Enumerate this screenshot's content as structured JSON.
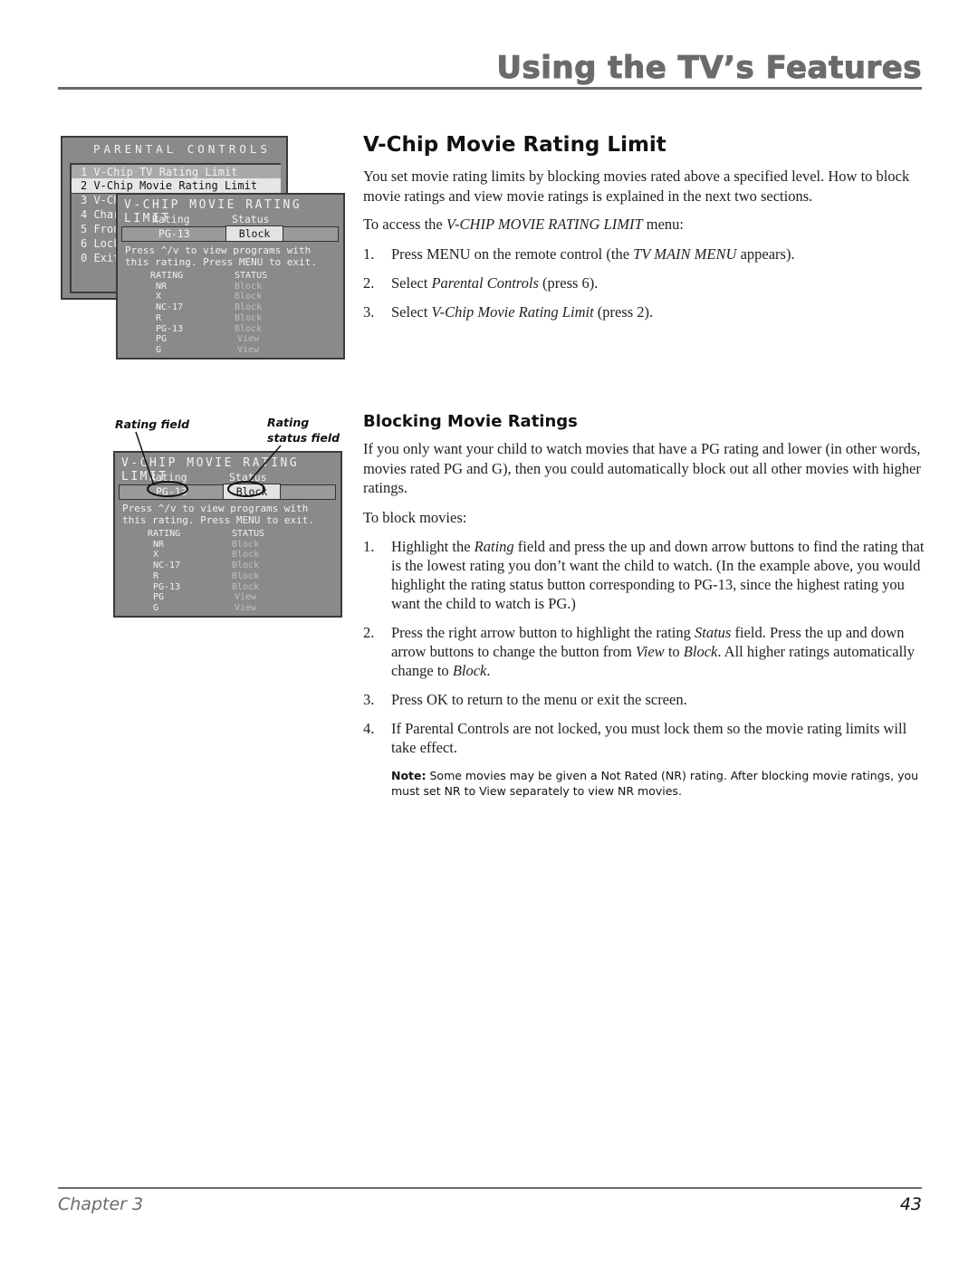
{
  "header": {
    "title": "Using the TV’s Features"
  },
  "parental_controls_menu": {
    "title": "PARENTAL CONTROLS",
    "items": [
      {
        "label": "1 V-Chip TV Rating Limit"
      },
      {
        "label": "2 V-Chip Movie Rating Limit"
      },
      {
        "label": "3 V-Ch"
      },
      {
        "label": "4 Char"
      },
      {
        "label": "5 Fron"
      },
      {
        "label": "6 Lock"
      },
      {
        "label": "0 Exit"
      }
    ]
  },
  "vchip_menu": {
    "title": "V-CHIP MOVIE RATING LIMIT",
    "rating_header": "Rating",
    "status_header": "Status",
    "rating_value": "PG-13",
    "status_value": "Block",
    "message_line1": "Press ^/v to view programs with",
    "message_line2": "this rating. Press MENU to exit.",
    "table_header": {
      "rating": "RATING",
      "status": "STATUS"
    },
    "rows": [
      {
        "rating": "NR",
        "status": "Block"
      },
      {
        "rating": "X",
        "status": "Block"
      },
      {
        "rating": "NC-17",
        "status": "Block"
      },
      {
        "rating": "R",
        "status": "Block"
      },
      {
        "rating": "PG-13",
        "status": "Block"
      },
      {
        "rating": "PG",
        "status": "View"
      },
      {
        "rating": "G",
        "status": "View"
      }
    ]
  },
  "callouts": {
    "rating_field": "Rating field",
    "rating_status_line1": "Rating",
    "rating_status_line2": "status field"
  },
  "section1": {
    "heading": "V-Chip Movie Rating Limit",
    "intro": "You set movie rating limits by blocking movies rated above a specified level. How to block movie ratings and view movie ratings is explained in the next two sections.",
    "access_pre": "To access the ",
    "access_em": "V-CHIP MOVIE RATING LIMIT",
    "access_post": " menu:",
    "steps": [
      {
        "num": "1.",
        "pre": "Press MENU on the remote control (the ",
        "em": "TV MAIN MENU",
        "post": " appears)."
      },
      {
        "num": "2.",
        "pre": "Select ",
        "em": "Parental Controls",
        "post": " (press 6)."
      },
      {
        "num": "3.",
        "pre": "Select ",
        "em": "V-Chip Movie Rating Limit",
        "post": " (press 2)."
      }
    ]
  },
  "section2": {
    "heading": "Blocking Movie Ratings",
    "intro": "If you only want your child to watch movies that have a PG rating and lower (in other words, movies rated PG and G), then you could automatically block out all other movies with higher ratings.",
    "lead": "To block movies:",
    "step1": {
      "num": "1.",
      "pre": "Highlight the ",
      "em": "Rating",
      "post": " field and press the up and down arrow buttons to find the rating that is the lowest rating you don’t want the child to watch.  (In the example above, you would highlight the rating status button corresponding to PG-13, since the highest rating you want the child to watch is PG.)"
    },
    "step2": {
      "num": "2.",
      "a": "Press the right arrow button to highlight the rating ",
      "em1": "Status",
      "b": " field. Press the up and down arrow buttons to change the button from ",
      "em2": "View",
      "c": " to ",
      "em3": "Block",
      "d": ". All higher ratings automatically change to ",
      "em4": "Block",
      "e": "."
    },
    "step3": {
      "num": "3.",
      "text": "Press OK to return to the menu or exit the screen."
    },
    "step4": {
      "num": "4.",
      "text": "If Parental Controls are not locked, you must lock them so the movie rating limits will take effect."
    },
    "note_label": "Note:",
    "note_text": " Some movies may be given a Not Rated (NR) rating. After blocking movie ratings, you must set NR to View separately to view NR movies."
  },
  "footer": {
    "chapter": "Chapter 3",
    "page": "43"
  }
}
